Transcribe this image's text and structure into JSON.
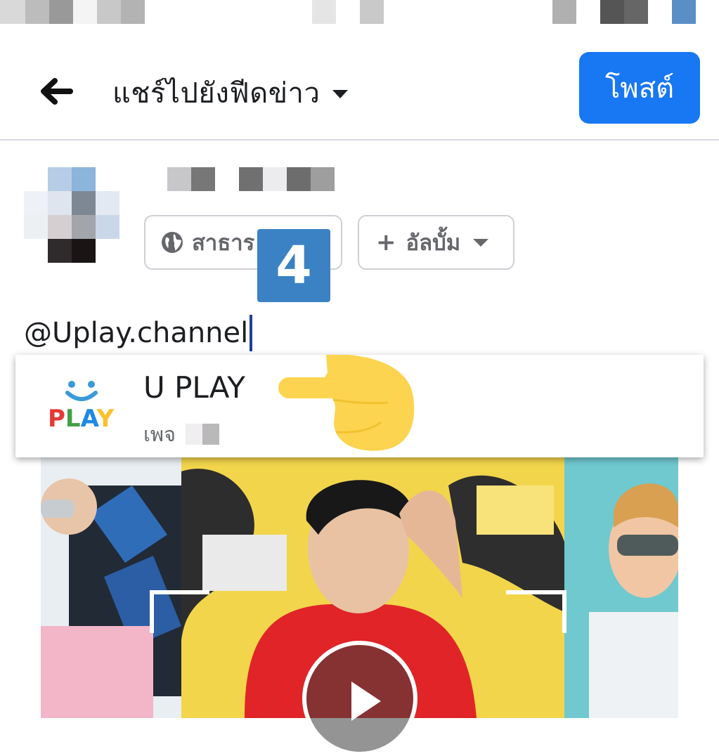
{
  "header": {
    "title": "แชร์ไปยังฟีดข่าว",
    "post_label": "โพสต์"
  },
  "composer": {
    "privacy_label": "สาธาร",
    "album_label": "อัลบั้ม",
    "text": "@Uplay.channel"
  },
  "tutorial": {
    "step_number": "4"
  },
  "suggestion": {
    "name": "U PLAY",
    "type": "เพจ",
    "logo_text": "PLAY"
  },
  "icons": {
    "back": "arrow-left-icon",
    "dropdown": "caret-down-icon",
    "privacy": "globe-icon",
    "album": "plus-icon",
    "pointer": "pointing-hand-icon",
    "play": "play-icon"
  },
  "colors": {
    "accent": "#1877f2",
    "step_badge": "#3b82c4",
    "hand": "#fdd44f",
    "text_secondary": "#65676b"
  }
}
